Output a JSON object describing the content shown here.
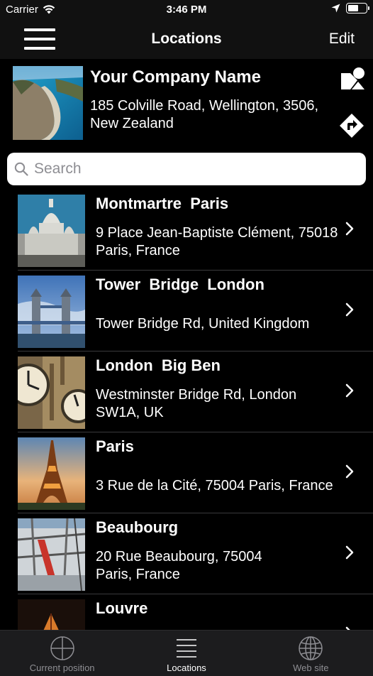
{
  "status_bar": {
    "carrier": "Carrier",
    "time": "3:46 PM",
    "battery_level": 0.6
  },
  "nav": {
    "title": "Locations",
    "edit_label": "Edit"
  },
  "company": {
    "name": "Your Company Name",
    "address": "185 Colville Road, Wellington, 3506, New Zealand"
  },
  "search": {
    "placeholder": "Search",
    "value": ""
  },
  "locations": [
    {
      "title": "Montmartre  Paris",
      "address": "9 Place Jean-Baptiste Clément, 75018 Paris, France"
    },
    {
      "title": "Tower  Bridge  London",
      "address": "Tower Bridge Rd, United Kingdom"
    },
    {
      "title": "London  Big Ben",
      "address": "Westminster Bridge Rd, London SW1A, UK"
    },
    {
      "title": "Paris",
      "address": "3 Rue de la Cité, 75004 Paris, France"
    },
    {
      "title": "Beaubourg",
      "address": "20 Rue Beaubourg, 75004\nParis, France"
    },
    {
      "title": "Louvre",
      "address": ""
    }
  ],
  "tabs": [
    {
      "label": "Current position",
      "icon": "crosshair-icon"
    },
    {
      "label": "Locations",
      "icon": "list-icon"
    },
    {
      "label": "Web site",
      "icon": "globe-icon"
    }
  ],
  "colors": {
    "background": "#000000",
    "bar": "#111111",
    "tab_bar": "#1c1c1e",
    "inactive": "#8e8e93"
  }
}
